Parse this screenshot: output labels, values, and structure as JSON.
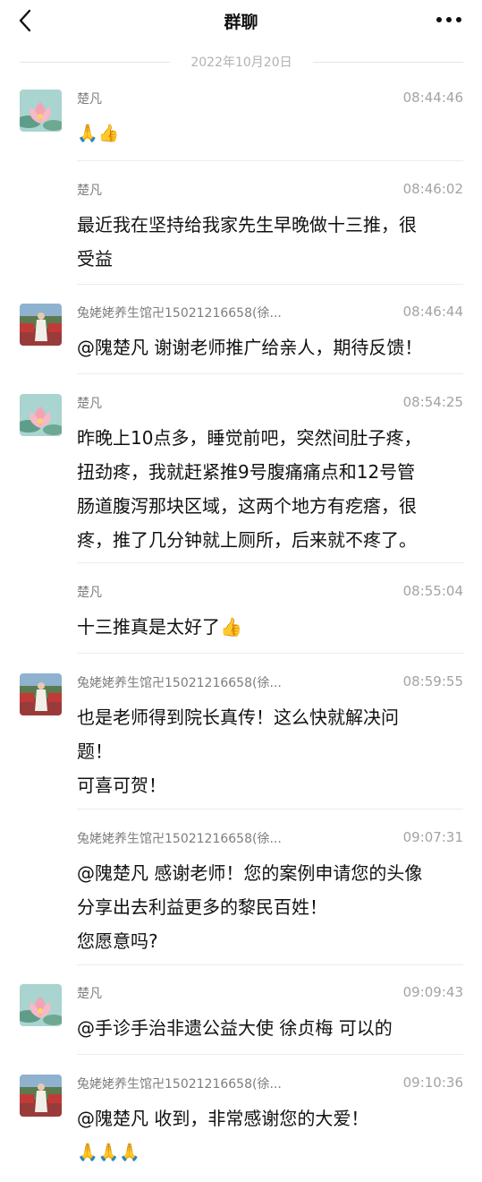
{
  "header": {
    "title": "群聊"
  },
  "date_divider": "2022年10月20日",
  "messages": [
    {
      "sender": "楚凡",
      "time": "08:44:46",
      "lines": [
        "🙏👍"
      ],
      "show_avatar": true,
      "avatar": "lotus"
    },
    {
      "sender": "楚凡",
      "time": "08:46:02",
      "lines": [
        "最近我在坚持给我家先生早晚做十三推，很",
        "受益"
      ],
      "show_avatar": false
    },
    {
      "sender": "兔姥姥养生馆卍15021216658(徐...",
      "time": "08:46:44",
      "lines": [
        "@隗楚凡 谢谢老师推广给亲人，期待反馈！"
      ],
      "show_avatar": true,
      "avatar": "person"
    },
    {
      "sender": "楚凡",
      "time": "08:54:25",
      "lines": [
        "昨晚上10点多，睡觉前吧，突然间肚子疼，",
        "扭劲疼，我就赶紧推9号腹痛痛点和12号管",
        "肠道腹泻那块区域，这两个地方有疙瘩，很",
        "疼，推了几分钟就上厕所，后来就不疼了。"
      ],
      "show_avatar": true,
      "avatar": "lotus"
    },
    {
      "sender": "楚凡",
      "time": "08:55:04",
      "lines": [
        "十三推真是太好了👍"
      ],
      "show_avatar": false
    },
    {
      "sender": "兔姥姥养生馆卍15021216658(徐...",
      "time": "08:59:55",
      "lines": [
        "也是老师得到院长真传！这么快就解决问",
        "题！",
        "可喜可贺！"
      ],
      "show_avatar": true,
      "avatar": "person"
    },
    {
      "sender": "兔姥姥养生馆卍15021216658(徐...",
      "time": "09:07:31",
      "lines": [
        "@隗楚凡 感谢老师！您的案例申请您的头像",
        "分享出去利益更多的黎民百姓！",
        "您愿意吗?"
      ],
      "show_avatar": false
    },
    {
      "sender": "楚凡",
      "time": "09:09:43",
      "lines": [
        "@手诊手治非遗公益大使 徐贞梅 可以的"
      ],
      "show_avatar": true,
      "avatar": "lotus"
    },
    {
      "sender": "兔姥姥养生馆卍15021216658(徐...",
      "time": "09:10:36",
      "lines": [
        "@隗楚凡 收到，非常感谢您的大爱！",
        "🙏🙏🙏"
      ],
      "show_avatar": true,
      "avatar": "person"
    }
  ],
  "icons": {
    "back": "chevron-left-icon",
    "more": "more-dots-icon"
  },
  "colors": {
    "background": "#ffffff",
    "meta_text": "#7d7d7d",
    "time_text": "#a3a3a3",
    "divider": "#ececec"
  }
}
